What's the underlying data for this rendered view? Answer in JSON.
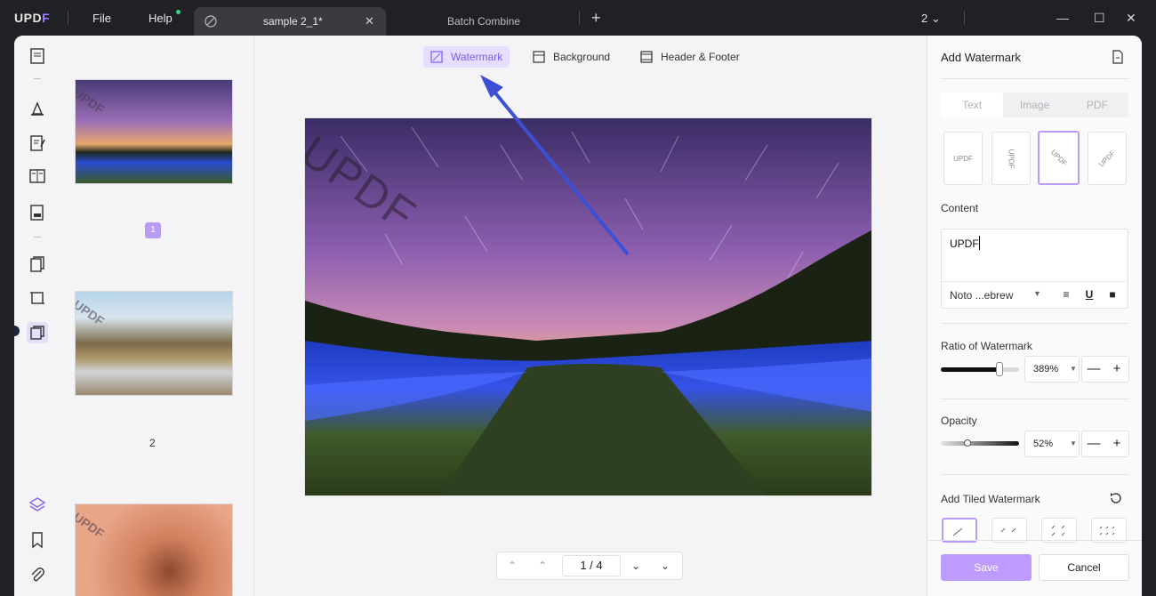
{
  "app": {
    "logo_u": "UPD",
    "logo_p": "F"
  },
  "menu": {
    "file": "File",
    "help": "Help"
  },
  "tabs": [
    {
      "title": "sample 2_1*",
      "close": "✕"
    },
    {
      "title": "Batch Combine"
    }
  ],
  "titlebar": {
    "add_tab": "+",
    "page_count": "2",
    "page_count_caret": "⌄"
  },
  "window": {
    "minimize": "—",
    "maximize": "☐",
    "close": "✕"
  },
  "toolbar": {
    "watermark": "Watermark",
    "background": "Background",
    "header_footer": "Header & Footer"
  },
  "thumbnails": [
    {
      "watermark": "UPDF",
      "badge": "1"
    },
    {
      "watermark": "UPDF",
      "page": "2"
    },
    {
      "watermark": "UPDF"
    }
  ],
  "document": {
    "watermark": "UPDF"
  },
  "pager": {
    "current": "1 / 4",
    "first": "⌃",
    "prev": "⌃",
    "next": "⌄",
    "last": "⌄"
  },
  "panel": {
    "title": "Add Watermark",
    "segments": [
      "Text",
      "Image",
      "PDF"
    ],
    "style_previews": [
      "UPDF",
      "UPDF",
      "UPDF",
      "UPDF"
    ],
    "content_label": "Content",
    "content_value": "UPDF",
    "font": "Noto ...ebrew",
    "format_align": "≡",
    "format_underline": "U",
    "format_fill": "■",
    "ratio_label": "Ratio of Watermark",
    "ratio_value": "389%",
    "ratio_level": 0.67,
    "opacity_label": "Opacity",
    "opacity_value": "52%",
    "opacity_level": 0.52,
    "minus": "—",
    "plus": "+",
    "tiled_label": "Add Tiled Watermark",
    "save": "Save",
    "cancel": "Cancel"
  },
  "colors": {
    "accent": "#b99cf4",
    "save_button": "#bd9bff",
    "toolbar_active_bg": "#e6ddff"
  }
}
